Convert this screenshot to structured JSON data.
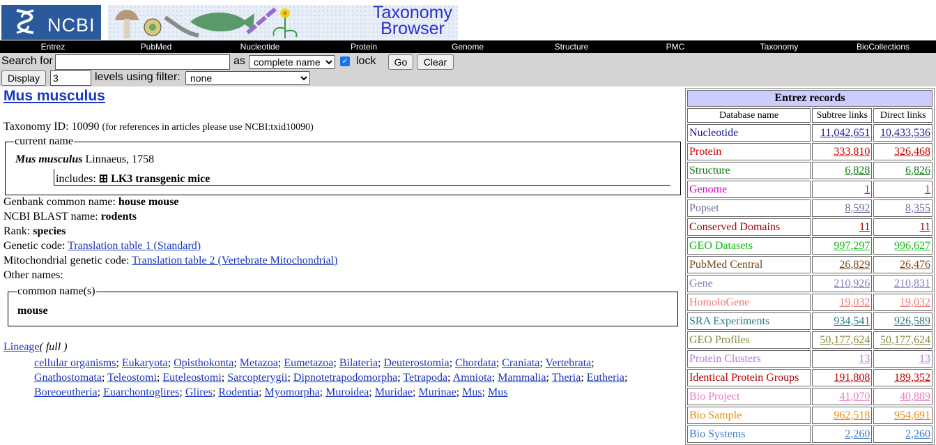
{
  "banner": {
    "ncbi_text": "NCBI",
    "taxonomy_line1": "Taxonomy",
    "taxonomy_line2": "Browser"
  },
  "nav": [
    "Entrez",
    "PubMed",
    "Nucleotide",
    "Protein",
    "Genome",
    "Structure",
    "PMC",
    "Taxonomy",
    "BioCollections"
  ],
  "search": {
    "label": "Search for",
    "value": "",
    "as_label": "as",
    "as_selected": "complete name",
    "lock_label": "lock",
    "lock_checked": true,
    "go_label": "Go",
    "clear_label": "Clear",
    "display_label": "Display",
    "levels_value": "3",
    "levels_label": "levels using filter:",
    "filter_selected": "none"
  },
  "taxon": {
    "name": "Mus musculus",
    "taxonomy_id_label": "Taxonomy ID:",
    "taxonomy_id": "10090",
    "taxonomy_id_note": "(for references in articles please use NCBI:txid10090)",
    "current_name_legend": "current name",
    "sci_name": "Mus musculus",
    "authority": "Linnaeus, 1758",
    "includes_label": "includes:",
    "includes_value": "⊞ LK3 transgenic mice",
    "genbank_label": "Genbank common name:",
    "genbank_value": "house mouse",
    "blast_label": "NCBI BLAST name:",
    "blast_value": "rodents",
    "rank_label": "Rank:",
    "rank_value": "species",
    "genetic_code_label": "Genetic code:",
    "genetic_code_value": "Translation table 1 (Standard)",
    "mito_code_label": "Mitochondrial genetic code:",
    "mito_code_value": "Translation table 2 (Vertebrate Mitochondrial)",
    "other_names_label": "Other names:",
    "common_names_legend": "common name(s)",
    "common_names_value": "mouse",
    "lineage_label": "Lineage",
    "lineage_full": "( full )",
    "lineage": [
      "cellular organisms",
      "Eukaryota",
      "Opisthokonta",
      "Metazoa",
      "Eumetazoa",
      "Bilateria",
      "Deuterostomia",
      "Chordata",
      "Craniata",
      "Vertebrata",
      "Gnathostomata",
      "Teleostomi",
      "Euteleostomi",
      "Sarcopterygii",
      "Dipnotetrapodomorpha",
      "Tetrapoda",
      "Amniota",
      "Mammalia",
      "Theria",
      "Eutheria",
      "Boreoeutheria",
      "Euarchontoglires",
      "Glires",
      "Rodentia",
      "Myomorpha",
      "Muroidea",
      "Muridae",
      "Murinae",
      "Mus",
      "Mus"
    ]
  },
  "records": {
    "caption": "Entrez records",
    "col_db": "Database name",
    "col_subtree": "Subtree links",
    "col_direct": "Direct links",
    "rows": [
      {
        "name": "Nucleotide",
        "subtree": "11,042,651",
        "direct": "10,433,536",
        "color": "#1a1a9c"
      },
      {
        "name": "Protein",
        "subtree": "333,810",
        "direct": "326,468",
        "color": "#cc0000"
      },
      {
        "name": "Structure",
        "subtree": "6,828",
        "direct": "6,826",
        "color": "#117711"
      },
      {
        "name": "Genome",
        "subtree": "1",
        "direct": "1",
        "color": "#cc00cc"
      },
      {
        "name": "Popset",
        "subtree": "8,592",
        "direct": "8,355",
        "color": "#6b6b9e"
      },
      {
        "name": "Conserved Domains",
        "subtree": "11",
        "direct": "11",
        "color": "#990000"
      },
      {
        "name": "GEO Datasets",
        "subtree": "997,297",
        "direct": "996,627",
        "color": "#11bb11"
      },
      {
        "name": "PubMed Central",
        "subtree": "26,829",
        "direct": "26,476",
        "color": "#7a4a1a"
      },
      {
        "name": "Gene",
        "subtree": "210,926",
        "direct": "210,831",
        "color": "#8080b8"
      },
      {
        "name": "HomoloGene",
        "subtree": "19,032",
        "direct": "19,032",
        "color": "#ee7777"
      },
      {
        "name": "SRA Experiments",
        "subtree": "934,541",
        "direct": "926,589",
        "color": "#2a7a7a"
      },
      {
        "name": "GEO Profiles",
        "subtree": "50,177,624",
        "direct": "50,177,624",
        "color": "#888844"
      },
      {
        "name": "Protein Clusters",
        "subtree": "13",
        "direct": "13",
        "color": "#bb77dd"
      },
      {
        "name": "Identical Protein Groups",
        "subtree": "191,808",
        "direct": "189,352",
        "color": "#bb0000"
      },
      {
        "name": "Bio Project",
        "subtree": "41,070",
        "direct": "40,889",
        "color": "#ee77bb"
      },
      {
        "name": "Bio Sample",
        "subtree": "962,518",
        "direct": "954,691",
        "color": "#ee8811"
      },
      {
        "name": "Bio Systems",
        "subtree": "2,260",
        "direct": "2,260",
        "color": "#3a7acc"
      }
    ]
  }
}
